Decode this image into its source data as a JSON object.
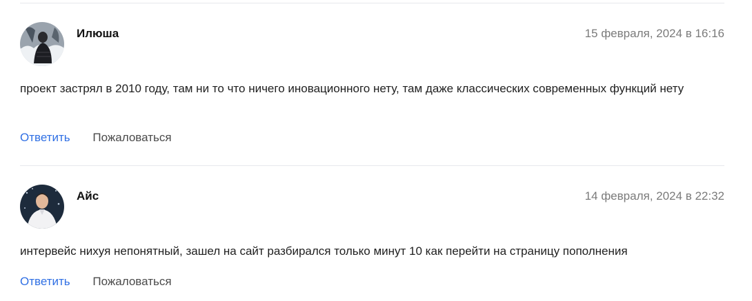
{
  "comments": [
    {
      "author": "Илюша",
      "date": "15 февраля, 2024 в 16:16",
      "text": "проект застрял в 2010 году, там ни то что ничего иновационного нету, там даже классических современных функций нету",
      "reply_label": "Ответить",
      "report_label": "Пожаловаться"
    },
    {
      "author": "Айс",
      "date": "14 февраля, 2024 в 22:32",
      "text": "интервейс нихуя непонятный, зашел на сайт разбирался только минут 10 как перейти на страницу пополнения",
      "reply_label": "Ответить",
      "report_label": "Пожаловаться"
    }
  ],
  "colors": {
    "link": "#2f6fe4",
    "date": "#7a7a7a",
    "divider": "#e6e8ec"
  }
}
